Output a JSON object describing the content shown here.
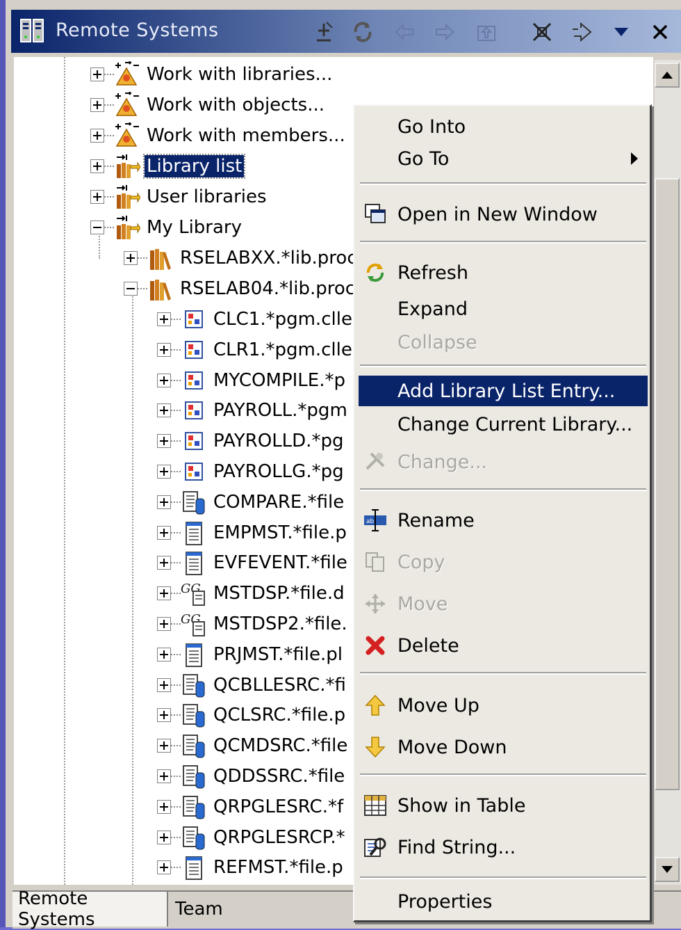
{
  "view": {
    "title": "Remote Systems",
    "toolbar_icons": [
      "remove-filter-icon",
      "refresh-icon",
      "back-icon",
      "forward-icon",
      "up-icon",
      "collapse-all-icon",
      "link-with-editor-icon",
      "view-menu-icon",
      "close-icon"
    ]
  },
  "tree": {
    "rows": [
      {
        "label": "Work with libraries...",
        "icon": "work-with-icon"
      },
      {
        "label": "Work with objects...",
        "icon": "work-with-icon"
      },
      {
        "label": "Work with members...",
        "icon": "work-with-icon"
      },
      {
        "label": "Library list",
        "icon": "library-filter-icon",
        "selected": true
      },
      {
        "label": "User libraries",
        "icon": "library-filter-icon"
      },
      {
        "label": "My Library",
        "icon": "library-filter-icon"
      },
      {
        "label": "RSELABXX.*lib.proc",
        "icon": "library-icon"
      },
      {
        "label": "RSELAB04.*lib.proc",
        "icon": "library-icon"
      },
      {
        "label": "CLC1.*pgm.clle",
        "icon": "program-icon"
      },
      {
        "label": "CLR1.*pgm.clle",
        "icon": "program-icon"
      },
      {
        "label": "MYCOMPILE.*p",
        "icon": "program-icon"
      },
      {
        "label": "PAYROLL.*pgm",
        "icon": "program-icon"
      },
      {
        "label": "PAYROLLD.*pg",
        "icon": "program-icon"
      },
      {
        "label": "PAYROLLG.*pg",
        "icon": "program-icon"
      },
      {
        "label": "COMPARE.*file",
        "icon": "source-file-icon"
      },
      {
        "label": "EMPMST.*file.p",
        "icon": "physical-file-icon"
      },
      {
        "label": "EVFEVENT.*file",
        "icon": "physical-file-icon"
      },
      {
        "label": "MSTDSP.*file.d",
        "icon": "display-file-icon"
      },
      {
        "label": "MSTDSP2.*file.",
        "icon": "display-file-icon"
      },
      {
        "label": "PRJMST.*file.pl",
        "icon": "physical-file-icon"
      },
      {
        "label": "QCBLLESRC.*fi",
        "icon": "source-file-icon"
      },
      {
        "label": "QCLSRC.*file.p",
        "icon": "source-file-icon"
      },
      {
        "label": "QCMDSRC.*file",
        "icon": "source-file-icon"
      },
      {
        "label": "QDDSSRC.*file",
        "icon": "source-file-icon"
      },
      {
        "label": "QRPGLESRC.*f",
        "icon": "source-file-icon"
      },
      {
        "label": "QRPGLESRCP.*",
        "icon": "source-file-icon"
      },
      {
        "label": "REFMST.*file.p",
        "icon": "physical-file-icon"
      }
    ]
  },
  "context_menu": {
    "items": [
      {
        "label": "Go Into",
        "icon": "",
        "enabled": true
      },
      {
        "label": "Go To",
        "icon": "",
        "enabled": true,
        "submenu": true
      },
      {
        "label": "Open in New Window",
        "icon": "new-window-icon",
        "enabled": true
      },
      {
        "label": "Refresh",
        "icon": "refresh-icon",
        "enabled": true
      },
      {
        "label": "Expand",
        "icon": "",
        "enabled": true
      },
      {
        "label": "Collapse",
        "icon": "",
        "enabled": false
      },
      {
        "label": "Add Library List Entry...",
        "icon": "",
        "enabled": true,
        "highlighted": true
      },
      {
        "label": "Change Current Library...",
        "icon": "",
        "enabled": true
      },
      {
        "label": "Change...",
        "icon": "change-icon",
        "enabled": false
      },
      {
        "label": "Rename",
        "icon": "rename-icon",
        "enabled": true
      },
      {
        "label": "Copy",
        "icon": "copy-icon",
        "enabled": false
      },
      {
        "label": "Move",
        "icon": "move-icon",
        "enabled": false
      },
      {
        "label": "Delete",
        "icon": "delete-icon",
        "enabled": true
      },
      {
        "label": "Move Up",
        "icon": "move-up-icon",
        "enabled": true
      },
      {
        "label": "Move Down",
        "icon": "move-down-icon",
        "enabled": true
      },
      {
        "label": "Show in Table",
        "icon": "table-icon",
        "enabled": true
      },
      {
        "label": "Find String...",
        "icon": "find-string-icon",
        "enabled": true
      },
      {
        "label": "Properties",
        "icon": "",
        "enabled": true
      }
    ]
  },
  "bottom_tabs": [
    {
      "label": "Remote Systems",
      "active": true
    },
    {
      "label": "Team",
      "active": false
    }
  ],
  "colors": {
    "title_gradient_start": "#0a246a",
    "selection": "#0a246a",
    "menu_background": "#ece9e2",
    "delete_red": "#d42020"
  }
}
